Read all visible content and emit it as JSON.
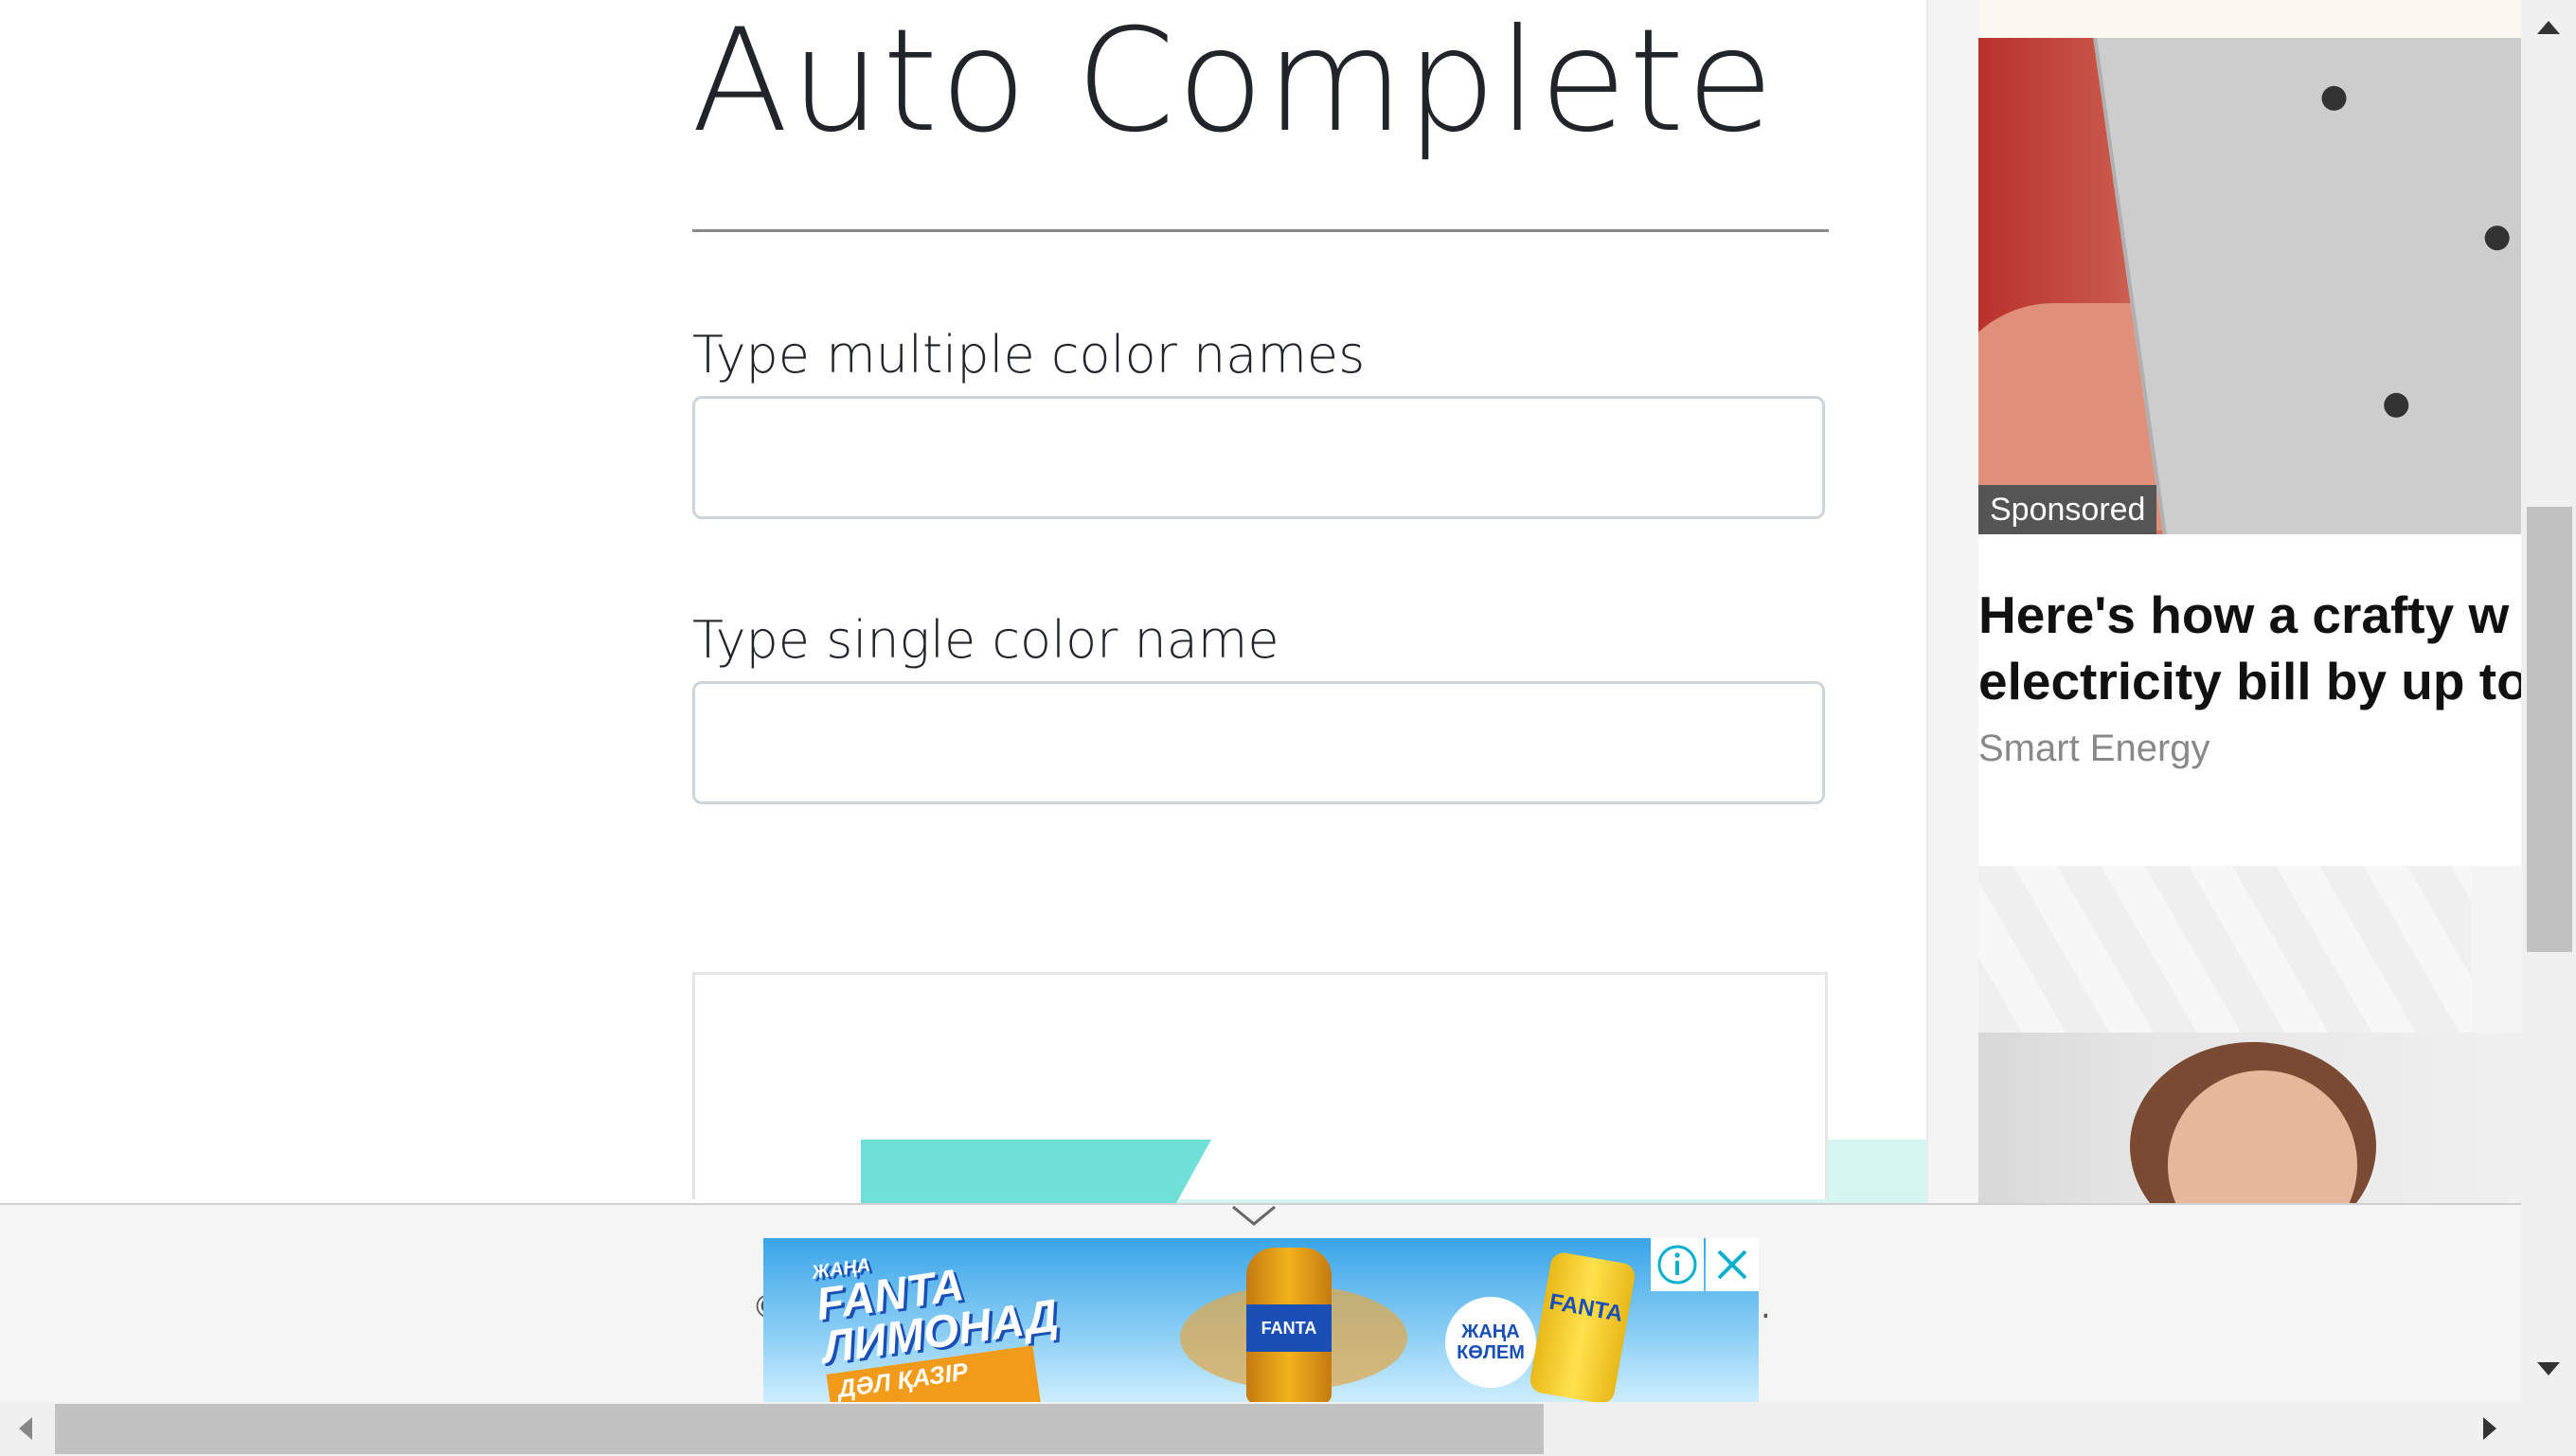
{
  "main": {
    "title": "Auto Complete",
    "multi_color_label": "Type multiple color names",
    "multi_color_value": "",
    "single_color_label": "Type single color name",
    "single_color_value": ""
  },
  "sidebar_ad": {
    "badge": "Sponsored",
    "headline": "Here's how a crafty w\nelectricity bill by up to",
    "source": "Smart Energy"
  },
  "bottom_ad": {
    "brand_small": "ЖАҢА",
    "brand_name": "FANTA",
    "product": "ЛИМОНАД",
    "cta": "ДӘЛ ҚАЗІР КӨР!",
    "bottle_label": "FANTA",
    "badge_line1": "ЖАҢА",
    "badge_line2": "КӨЛЕМ",
    "can_label": "FANTA",
    "info_icon": "info-icon",
    "close_icon": "close-icon"
  },
  "footer": {
    "left_fragment": "©",
    "right_fragment": "."
  },
  "colors": {
    "accent_teal": "#6fe0d7",
    "fanta_blue": "#1a4fb5",
    "fanta_orange": "#f29a1a"
  }
}
